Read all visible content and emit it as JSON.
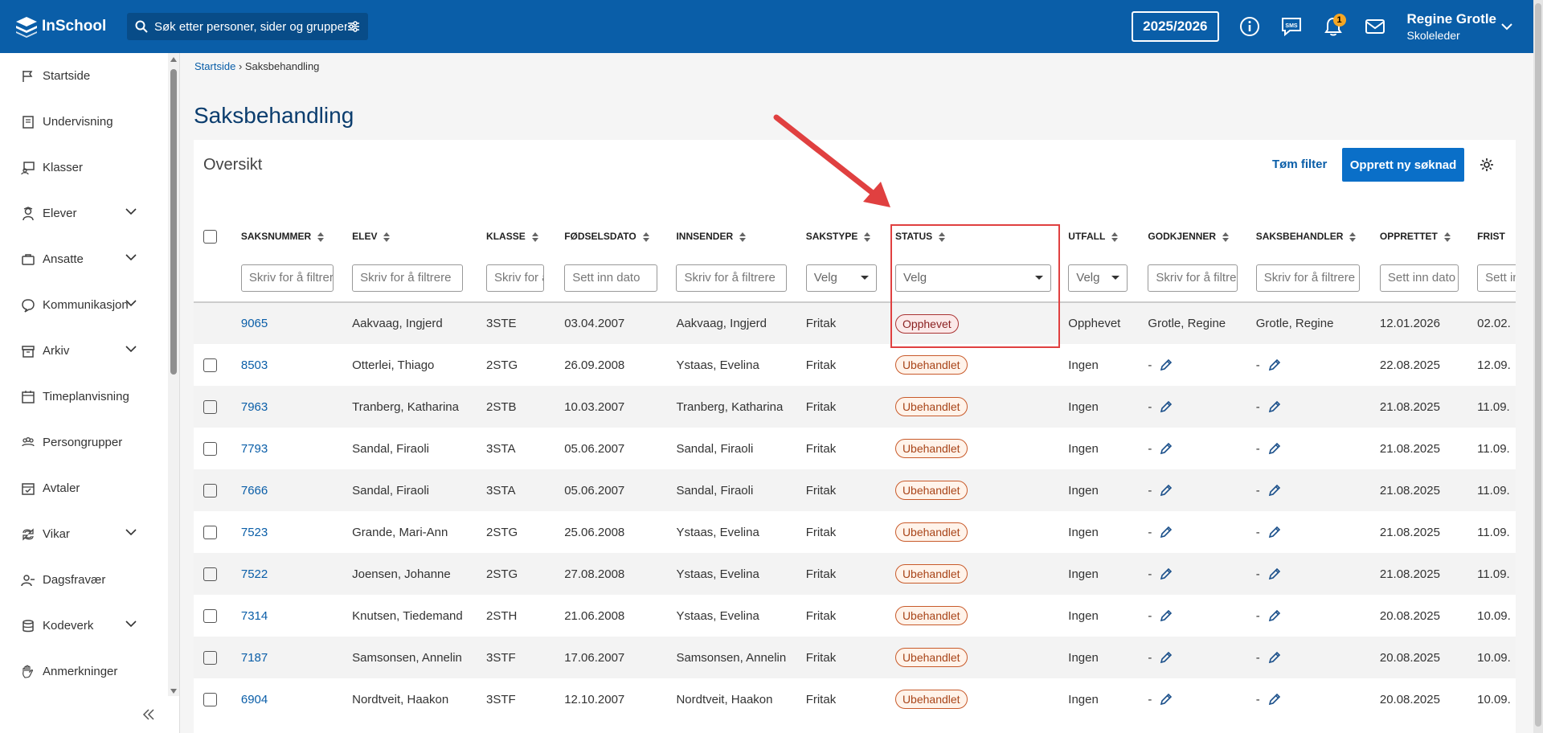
{
  "topbar": {
    "logo": "InSchool",
    "search_placeholder": "Søk etter personer, sider og grupper",
    "school_year": "2025/2026",
    "notification_count": "1",
    "user_name": "Regine Grotle",
    "user_role": "Skoleleder"
  },
  "sidebar": {
    "items": [
      {
        "label": "Startside",
        "icon": "flag-icon",
        "expandable": false
      },
      {
        "label": "Undervisning",
        "icon": "book-icon",
        "expandable": false
      },
      {
        "label": "Klasser",
        "icon": "classroom-icon",
        "expandable": false
      },
      {
        "label": "Elever",
        "icon": "student-icon",
        "expandable": true
      },
      {
        "label": "Ansatte",
        "icon": "briefcase-icon",
        "expandable": true
      },
      {
        "label": "Kommunikasjon",
        "icon": "chat-icon",
        "expandable": true
      },
      {
        "label": "Arkiv",
        "icon": "archive-icon",
        "expandable": true
      },
      {
        "label": "Timeplanvisning",
        "icon": "calendar-icon",
        "expandable": false
      },
      {
        "label": "Persongrupper",
        "icon": "group-icon",
        "expandable": false
      },
      {
        "label": "Avtaler",
        "icon": "calendar-check-icon",
        "expandable": false
      },
      {
        "label": "Vikar",
        "icon": "swap-icon",
        "expandable": true
      },
      {
        "label": "Dagsfravær",
        "icon": "user-absence-icon",
        "expandable": false
      },
      {
        "label": "Kodeverk",
        "icon": "database-icon",
        "expandable": true
      },
      {
        "label": "Anmerkninger",
        "icon": "hand-icon",
        "expandable": false
      }
    ]
  },
  "breadcrumb": {
    "home": "Startside",
    "current": "Saksbehandling"
  },
  "page": {
    "title": "Saksbehandling",
    "panel_title": "Oversikt",
    "clear_filter": "Tøm filter",
    "new_application": "Opprett ny søknad"
  },
  "table": {
    "columns": [
      "SAKSNUMMER",
      "ELEV",
      "KLASSE",
      "FØDSELSDATO",
      "INNSENDER",
      "SAKSTYPE",
      "STATUS",
      "UTFALL",
      "GODKJENNER",
      "SAKSBEHANDLER",
      "OPPRETTET",
      "FRIST"
    ],
    "filters": [
      "Skriv for å filtrere",
      "Skriv for å filtrere",
      "Skriv for å filtrere",
      "Sett inn dato",
      "Skriv for å filtrere",
      "Velg",
      "Velg",
      "Velg",
      "Skriv for å filtrere",
      "Skriv for å filtrere",
      "Sett inn dato",
      "Sett inn dato"
    ],
    "rows": [
      {
        "num": "9065",
        "elev": "Aakvaag, Ingjerd",
        "klasse": "3STE",
        "dato": "03.04.2007",
        "innsender": "Aakvaag, Ingjerd",
        "type": "Fritak",
        "status": "Opphevet",
        "utfall": "Opphevet",
        "godkjenner": "Grotle, Regine",
        "saksbehandler": "Grotle, Regine",
        "opprettet": "12.01.2026",
        "frist": "02.02.",
        "checkbox": false
      },
      {
        "num": "8503",
        "elev": "Otterlei, Thiago",
        "klasse": "2STG",
        "dato": "26.09.2008",
        "innsender": "Ystaas, Evelina",
        "type": "Fritak",
        "status": "Ubehandlet",
        "utfall": "Ingen",
        "godkjenner": "-",
        "saksbehandler": "-",
        "opprettet": "22.08.2025",
        "frist": "12.09.",
        "checkbox": true
      },
      {
        "num": "7963",
        "elev": "Tranberg, Katharina",
        "klasse": "2STB",
        "dato": "10.03.2007",
        "innsender": "Tranberg, Katharina",
        "type": "Fritak",
        "status": "Ubehandlet",
        "utfall": "Ingen",
        "godkjenner": "-",
        "saksbehandler": "-",
        "opprettet": "21.08.2025",
        "frist": "11.09.",
        "checkbox": true
      },
      {
        "num": "7793",
        "elev": "Sandal, Firaoli",
        "klasse": "3STA",
        "dato": "05.06.2007",
        "innsender": "Sandal, Firaoli",
        "type": "Fritak",
        "status": "Ubehandlet",
        "utfall": "Ingen",
        "godkjenner": "-",
        "saksbehandler": "-",
        "opprettet": "21.08.2025",
        "frist": "11.09.",
        "checkbox": true
      },
      {
        "num": "7666",
        "elev": "Sandal, Firaoli",
        "klasse": "3STA",
        "dato": "05.06.2007",
        "innsender": "Sandal, Firaoli",
        "type": "Fritak",
        "status": "Ubehandlet",
        "utfall": "Ingen",
        "godkjenner": "-",
        "saksbehandler": "-",
        "opprettet": "21.08.2025",
        "frist": "11.09.",
        "checkbox": true
      },
      {
        "num": "7523",
        "elev": "Grande, Mari-Ann",
        "klasse": "2STG",
        "dato": "25.06.2008",
        "innsender": "Ystaas, Evelina",
        "type": "Fritak",
        "status": "Ubehandlet",
        "utfall": "Ingen",
        "godkjenner": "-",
        "saksbehandler": "-",
        "opprettet": "21.08.2025",
        "frist": "11.09.",
        "checkbox": true
      },
      {
        "num": "7522",
        "elev": "Joensen, Johanne",
        "klasse": "2STG",
        "dato": "27.08.2008",
        "innsender": "Ystaas, Evelina",
        "type": "Fritak",
        "status": "Ubehandlet",
        "utfall": "Ingen",
        "godkjenner": "-",
        "saksbehandler": "-",
        "opprettet": "21.08.2025",
        "frist": "11.09.",
        "checkbox": true
      },
      {
        "num": "7314",
        "elev": "Knutsen, Tiedemand",
        "klasse": "2STH",
        "dato": "21.06.2008",
        "innsender": "Ystaas, Evelina",
        "type": "Fritak",
        "status": "Ubehandlet",
        "utfall": "Ingen",
        "godkjenner": "-",
        "saksbehandler": "-",
        "opprettet": "20.08.2025",
        "frist": "10.09.",
        "checkbox": true
      },
      {
        "num": "7187",
        "elev": "Samsonsen, Annelin",
        "klasse": "3STF",
        "dato": "17.06.2007",
        "innsender": "Samsonsen, Annelin",
        "type": "Fritak",
        "status": "Ubehandlet",
        "utfall": "Ingen",
        "godkjenner": "-",
        "saksbehandler": "-",
        "opprettet": "20.08.2025",
        "frist": "10.09.",
        "checkbox": true
      },
      {
        "num": "6904",
        "elev": "Nordtveit, Haakon",
        "klasse": "3STF",
        "dato": "12.10.2007",
        "innsender": "Nordtveit, Haakon",
        "type": "Fritak",
        "status": "Ubehandlet",
        "utfall": "Ingen",
        "godkjenner": "-",
        "saksbehandler": "-",
        "opprettet": "20.08.2025",
        "frist": "10.09.",
        "checkbox": true
      }
    ]
  },
  "colors": {
    "primary": "#0a5ea8",
    "annotation": "#e04040",
    "status_opphevet": "#8a1f1f",
    "status_ubehandlet": "#a84418"
  }
}
